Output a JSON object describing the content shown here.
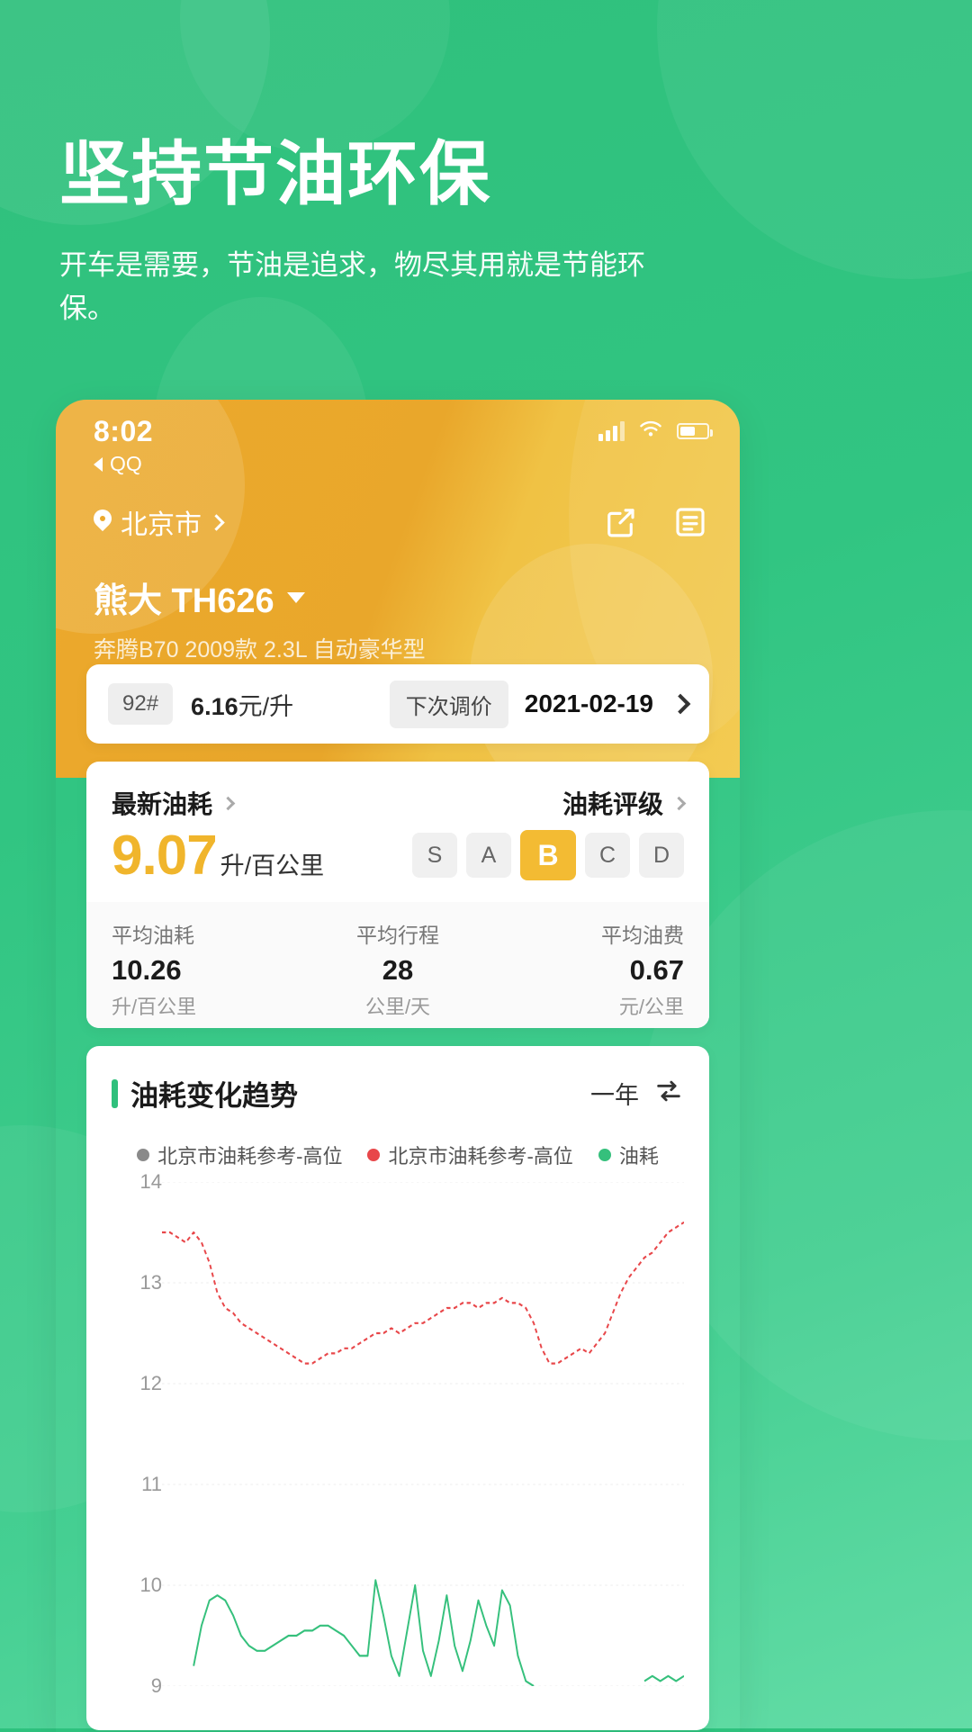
{
  "promo": {
    "title": "坚持节油环保",
    "subtitle": "开车是需要，节油是追求，物尽其用就是节能环保。"
  },
  "phone": {
    "statusbar": {
      "time": "8:02",
      "back_app": "QQ",
      "signal_icon": "signal-bars-icon",
      "wifi_icon": "wifi-icon",
      "battery_icon": "battery-icon"
    },
    "header": {
      "city": "北京市",
      "city_chevron_icon": "chevron-right-icon",
      "location_icon": "location-pin-icon",
      "share_icon": "share-icon",
      "list_icon": "list-icon",
      "car_name": "熊大 TH626",
      "car_caret_icon": "caret-down-icon",
      "car_model": "奔腾B70 2009款 2.3L 自动豪华型"
    },
    "price_card": {
      "fuel_grade": "92#",
      "price_value": "6.16",
      "price_unit": "元/升",
      "next_adjust_label": "下次调价",
      "next_adjust_date": "2021-02-19",
      "chevron_icon": "chevron-right-icon"
    },
    "consumption_card": {
      "latest_label": "最新油耗",
      "latest_chevron_icon": "chevron-right-icon",
      "rating_label": "油耗评级",
      "rating_chevron_icon": "chevron-right-icon",
      "value": "9.07",
      "unit": "升/百公里",
      "grades": [
        "S",
        "A",
        "B",
        "C",
        "D"
      ],
      "active_grade": "B",
      "stats": [
        {
          "title": "平均油耗",
          "value": "10.26",
          "unit": "升/百公里"
        },
        {
          "title": "平均行程",
          "value": "28",
          "unit": "公里/天"
        },
        {
          "title": "平均油费",
          "value": "0.67",
          "unit": "元/公里"
        }
      ]
    },
    "trend_card": {
      "title": "油耗变化趋势",
      "range_label": "一年",
      "swap_icon": "swap-vertical-icon"
    }
  },
  "chart_data": {
    "type": "line",
    "title": "油耗变化趋势",
    "xlabel": "",
    "ylabel": "",
    "ylim": [
      9,
      14
    ],
    "yticks": [
      9,
      10,
      11,
      12,
      13,
      14
    ],
    "grid": true,
    "legend_position": "top-center",
    "legend": [
      {
        "name": "北京市油耗参考-高位",
        "color": "#8a8a8a"
      },
      {
        "name": "北京市油耗参考-高位",
        "color": "#e8474a"
      },
      {
        "name": "油耗",
        "color": "#35c07c"
      }
    ],
    "series": [
      {
        "name": "北京市油耗参考-高位",
        "color": "#e8474a",
        "style": "dashed",
        "values": [
          13.5,
          13.5,
          13.45,
          13.4,
          13.5,
          13.4,
          13.2,
          12.9,
          12.75,
          12.7,
          12.6,
          12.55,
          12.5,
          12.45,
          12.4,
          12.35,
          12.3,
          12.25,
          12.2,
          12.2,
          12.25,
          12.3,
          12.3,
          12.35,
          12.35,
          12.4,
          12.45,
          12.5,
          12.5,
          12.55,
          12.5,
          12.55,
          12.6,
          12.6,
          12.65,
          12.7,
          12.75,
          12.75,
          12.8,
          12.8,
          12.75,
          12.8,
          12.8,
          12.85,
          12.8,
          12.8,
          12.75,
          12.6,
          12.35,
          12.2,
          12.2,
          12.25,
          12.3,
          12.35,
          12.3,
          12.4,
          12.5,
          12.7,
          12.9,
          13.05,
          13.15,
          13.25,
          13.3,
          13.4,
          13.5,
          13.55,
          13.6
        ]
      },
      {
        "name": "油耗",
        "color": "#35c07c",
        "style": "solid",
        "values": [
          null,
          null,
          null,
          null,
          9.2,
          9.6,
          9.85,
          9.9,
          9.85,
          9.7,
          9.5,
          9.4,
          9.35,
          9.35,
          9.4,
          9.45,
          9.5,
          9.5,
          9.55,
          9.55,
          9.6,
          9.6,
          9.55,
          9.5,
          9.4,
          9.3,
          9.3,
          10.05,
          9.7,
          9.3,
          9.1,
          9.55,
          10.0,
          9.35,
          9.1,
          9.45,
          9.9,
          9.4,
          9.15,
          9.45,
          9.85,
          9.6,
          9.4,
          9.95,
          9.8,
          9.3,
          9.05,
          9.0,
          null,
          null,
          null,
          null,
          null,
          null,
          null,
          null,
          null,
          null,
          null,
          null,
          null,
          9.05,
          9.1,
          9.05,
          9.1,
          9.05,
          9.1
        ]
      }
    ]
  }
}
